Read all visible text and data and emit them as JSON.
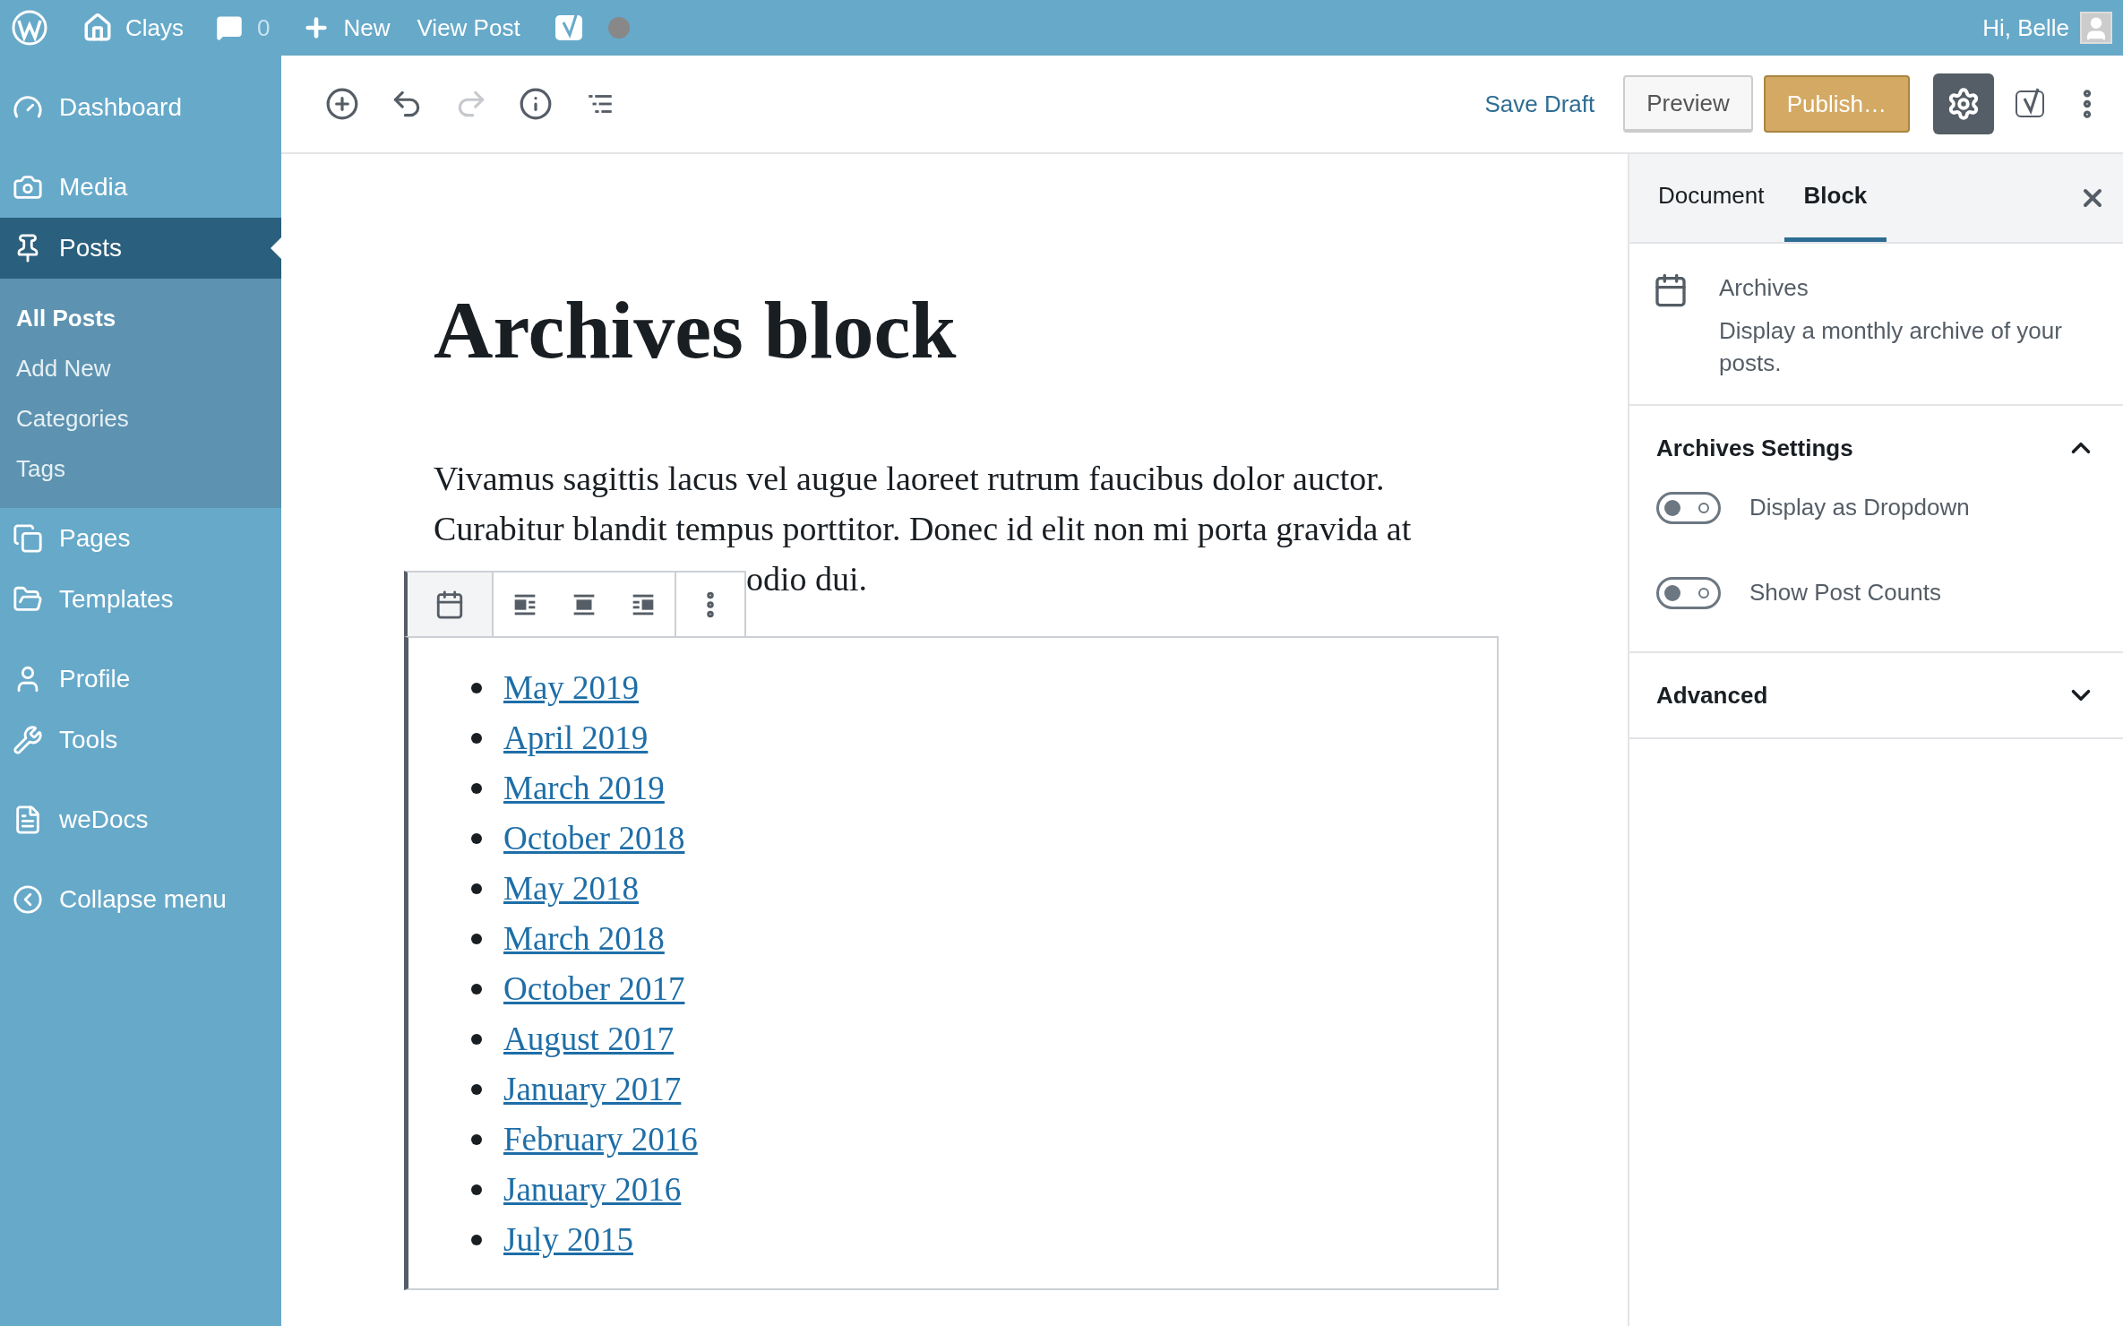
{
  "admin_bar": {
    "site": "Clays",
    "comments": "0",
    "new": "New",
    "view": "View Post",
    "greeting": "Hi, Belle"
  },
  "sidebar": {
    "groups": [
      {
        "items": [
          {
            "label": "Dashboard",
            "selected": false
          }
        ]
      },
      {
        "items": [
          {
            "label": "Media",
            "selected": false
          },
          {
            "label": "Posts",
            "selected": true,
            "children": [
              {
                "label": "All Posts",
                "selected": true
              },
              {
                "label": "Add New",
                "selected": false
              },
              {
                "label": "Categories",
                "selected": false
              },
              {
                "label": "Tags",
                "selected": false
              }
            ]
          },
          {
            "label": "Pages",
            "selected": false
          },
          {
            "label": "Templates",
            "selected": false
          }
        ]
      },
      {
        "items": [
          {
            "label": "Profile",
            "selected": false
          },
          {
            "label": "Tools",
            "selected": false
          }
        ]
      },
      {
        "items": [
          {
            "label": "weDocs",
            "selected": false
          }
        ]
      },
      {
        "items": [
          {
            "label": "Collapse menu",
            "selected": false
          }
        ]
      }
    ]
  },
  "toolbar": {
    "tools": [
      {
        "disabled": false
      },
      {
        "disabled": false
      },
      {
        "disabled": true
      },
      {
        "disabled": false
      },
      {
        "disabled": false
      }
    ],
    "save_draft": "Save Draft",
    "preview": "Preview",
    "publish": "Publish…",
    "settings_pressed": true
  },
  "post": {
    "title": "Archives block",
    "paragraph": "Vivamus sagittis lacus vel augue laoreet rutrum faucibus dolor auctor. Curabitur blandit tempus porttitor. Donec id elit non mi porta gravida at",
    "paragraph_tail": "odio dui.",
    "archives": [
      "May 2019",
      "April 2019",
      "March 2019",
      "October 2018",
      "May 2018",
      "March 2018",
      "October 2017",
      "August 2017",
      "January 2017",
      "February 2016",
      "January 2016",
      "July 2015"
    ]
  },
  "settings": {
    "tabs": [
      {
        "label": "Document",
        "selected": false
      },
      {
        "label": "Block",
        "selected": true
      }
    ],
    "block": {
      "name": "Archives",
      "description": "Display a monthly archive of your posts."
    },
    "panels": [
      {
        "title": "Archives Settings",
        "expanded": true,
        "toggles": [
          {
            "label": "Display as Dropdown",
            "on": false
          },
          {
            "label": "Show Post Counts",
            "on": false
          }
        ]
      },
      {
        "title": "Advanced",
        "expanded": false
      }
    ]
  }
}
